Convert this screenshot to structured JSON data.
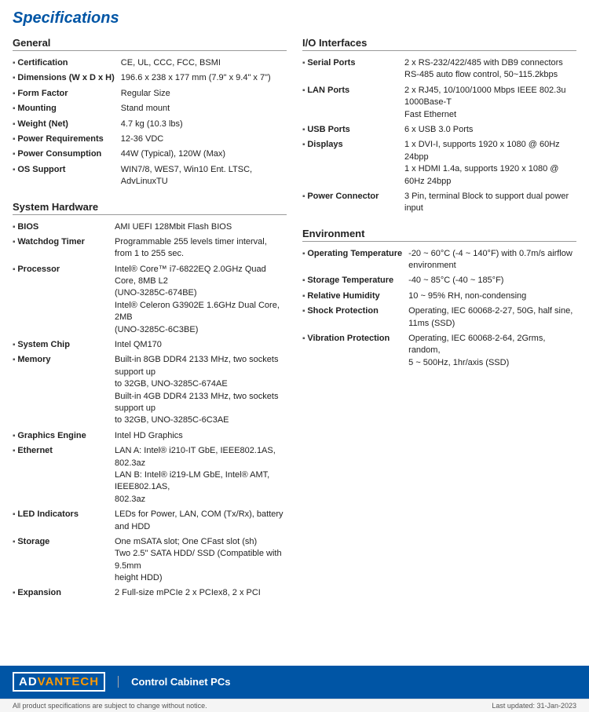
{
  "title": "Specifications",
  "sections": {
    "general": {
      "title": "General",
      "rows": [
        {
          "label": "Certification",
          "value": "CE, UL, CCC, FCC, BSMI"
        },
        {
          "label": "Dimensions (W x D x H)",
          "value": "196.6 x 238 x 177 mm (7.9\" x 9.4\" x 7\")"
        },
        {
          "label": "Form Factor",
          "value": "Regular Size"
        },
        {
          "label": "Mounting",
          "value": "Stand mount"
        },
        {
          "label": "Weight (Net)",
          "value": "4.7 kg (10.3 lbs)"
        },
        {
          "label": "Power Requirements",
          "value": "12-36 VDC"
        },
        {
          "label": "Power Consumption",
          "value": "44W (Typical), 120W (Max)"
        },
        {
          "label": "OS Support",
          "value": "WIN7/8, WES7, Win10 Ent. LTSC, AdvLinuxTU"
        }
      ]
    },
    "system_hardware": {
      "title": "System Hardware",
      "rows": [
        {
          "label": "BIOS",
          "value": "AMI UEFI 128Mbit Flash BIOS"
        },
        {
          "label": "Watchdog Timer",
          "value": "Programmable 255 levels timer interval,\nfrom 1 to 255 sec."
        },
        {
          "label": "Processor",
          "value": "Intel® Core™ i7-6822EQ 2.0GHz Quad Core, 8MB L2\n(UNO-3285C-674BE)\nIntel® Celeron G3902E 1.6GHz Dual Core, 2MB\n(UNO-3285C-6C3BE)"
        },
        {
          "label": "System Chip",
          "value": "Intel QM170"
        },
        {
          "label": "Memory",
          "value": "Built-in 8GB DDR4 2133 MHz, two sockets support up\nto 32GB, UNO-3285C-674AE\nBuilt-in 4GB DDR4 2133 MHz, two sockets support up\nto 32GB, UNO-3285C-6C3AE"
        },
        {
          "label": "Graphics Engine",
          "value": "Intel HD Graphics"
        },
        {
          "label": "Ethernet",
          "value": "LAN A: Intel® i210-IT GbE, IEEE802.1AS, 802.3az\nLAN B: Intel® i219-LM GbE, Intel® AMT, IEEE802.1AS,\n802.3az"
        },
        {
          "label": "LED Indicators",
          "value": "LEDs for Power, LAN, COM (Tx/Rx), battery and HDD"
        },
        {
          "label": "Storage",
          "value": "One mSATA slot; One CFast slot (sh)\nTwo 2.5\" SATA HDD/ SSD (Compatible with 9.5mm\nheight HDD)"
        },
        {
          "label": "Expansion",
          "value": "2 Full-size mPCIe 2 x PCIex8, 2 x PCI"
        }
      ]
    },
    "io_interfaces": {
      "title": "I/O Interfaces",
      "rows": [
        {
          "label": "Serial Ports",
          "value": "2 x RS-232/422/485 with DB9 connectors\nRS-485 auto flow control, 50~115.2kbps"
        },
        {
          "label": "LAN Ports",
          "value": "2 x RJ45, 10/100/1000 Mbps IEEE 802.3u 1000Base-T\nFast Ethernet"
        },
        {
          "label": "USB Ports",
          "value": "6 x USB 3.0 Ports"
        },
        {
          "label": "Displays",
          "value": "1 x DVI-I, supports 1920 x 1080 @ 60Hz 24bpp\n1 x HDMI 1.4a, supports 1920 x 1080 @ 60Hz 24bpp"
        },
        {
          "label": "Power Connector",
          "value": "3 Pin, terminal Block to support dual power input"
        }
      ]
    },
    "environment": {
      "title": "Environment",
      "rows": [
        {
          "label": "Operating Temperature",
          "value": "-20 ~ 60°C (-4 ~ 140°F) with 0.7m/s airflow\nenvironment"
        },
        {
          "label": "Storage Temperature",
          "value": "-40 ~ 85°C (-40 ~ 185°F)"
        },
        {
          "label": "Relative Humidity",
          "value": "10 ~ 95% RH, non-condensing"
        },
        {
          "label": "Shock Protection",
          "value": "Operating, IEC 60068-2-27, 50G, half sine,\n11ms (SSD)"
        },
        {
          "label": "Vibration Protection",
          "value": "Operating, IEC 60068-2-64, 2Grms, random,\n5 ~ 500Hz, 1hr/axis (SSD)"
        }
      ]
    }
  },
  "footer": {
    "logo_advan": "AD",
    "logo_vantech": "VANTECH",
    "logo_display": "ADVANTECH",
    "product_category": "Control Cabinet PCs",
    "disclaimer": "All product specifications are subject to change without notice.",
    "last_updated": "Last updated: 31-Jan-2023"
  }
}
